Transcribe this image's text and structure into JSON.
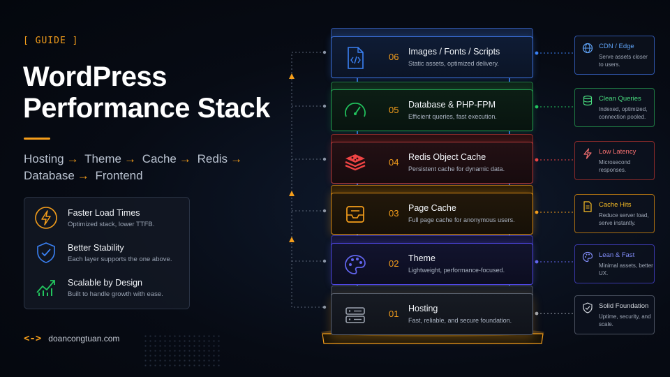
{
  "guide_tag": "[ GUIDE ]",
  "title": {
    "line1": "WordPress",
    "line2": "Performance Stack"
  },
  "flow": [
    "Hosting",
    "Theme",
    "Cache",
    "Redis",
    "Database",
    "Frontend"
  ],
  "benefits": [
    {
      "title": "Faster Load Times",
      "desc": "Optimized stack, lower TTFB.",
      "icon": "lightning-icon"
    },
    {
      "title": "Better Stability",
      "desc": "Each layer supports the one above.",
      "icon": "shield-check-icon"
    },
    {
      "title": "Scalable by Design",
      "desc": "Built to handle growth with ease.",
      "icon": "growth-chart-icon"
    }
  ],
  "brand": {
    "symbol": "<->",
    "name": "doancongtuan.com"
  },
  "layers": [
    {
      "num": "06",
      "title": "Images / Fonts / Scripts",
      "desc": "Static assets, optimized delivery.",
      "icon": "code-file-icon",
      "color": "#3b82f6"
    },
    {
      "num": "05",
      "title": "Database & PHP-FPM",
      "desc": "Efficient queries, fast execution.",
      "icon": "gauge-icon",
      "color": "#22c55e"
    },
    {
      "num": "04",
      "title": "Redis Object Cache",
      "desc": "Persistent cache for dynamic data.",
      "icon": "redis-icon",
      "color": "#ef4444"
    },
    {
      "num": "03",
      "title": "Page Cache",
      "desc": "Full page cache for anonymous users.",
      "icon": "inbox-tray-icon",
      "color": "#f59e1b"
    },
    {
      "num": "02",
      "title": "Theme",
      "desc": "Lightweight, performance-focused.",
      "icon": "palette-icon",
      "color": "#4f46e5"
    },
    {
      "num": "01",
      "title": "Hosting",
      "desc": "Fast, reliable, and secure foundation.",
      "icon": "server-icon",
      "color": "#9ca3af"
    }
  ],
  "side_cards": [
    {
      "title": "CDN / Edge",
      "desc": "Serve assets closer to users.",
      "icon": "globe-icon",
      "color": "#60a5fa"
    },
    {
      "title": "Clean Queries",
      "desc": "Indexed, optimized, connection pooled.",
      "icon": "database-icon",
      "color": "#4ade80"
    },
    {
      "title": "Low Latency",
      "desc": "Microsecond responses.",
      "icon": "lightning-icon",
      "color": "#f87171"
    },
    {
      "title": "Cache Hits",
      "desc": "Reduce server load, serve instantly.",
      "icon": "document-icon",
      "color": "#fbbf24"
    },
    {
      "title": "Lean & Fast",
      "desc": "Minimal assets, better UX.",
      "icon": "palette-icon",
      "color": "#818cf8"
    },
    {
      "title": "Solid Foundation",
      "desc": "Uptime, security, and scale.",
      "icon": "shield-check-icon",
      "color": "#d1d5db"
    }
  ]
}
